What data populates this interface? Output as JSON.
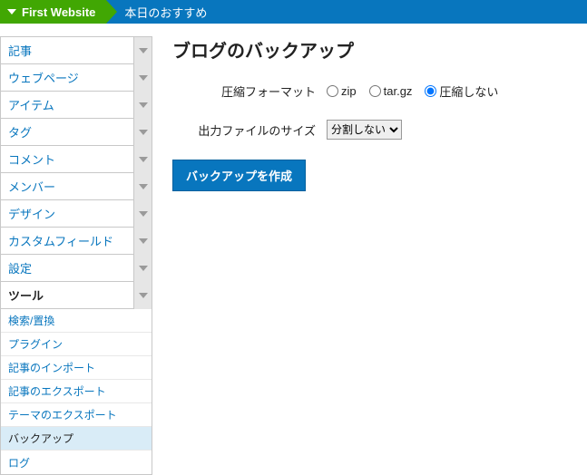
{
  "breadcrumb": {
    "site": "First Website",
    "page": "本日のおすすめ"
  },
  "sidebar": {
    "items": [
      {
        "label": "記事",
        "active": false
      },
      {
        "label": "ウェブページ",
        "active": false
      },
      {
        "label": "アイテム",
        "active": false
      },
      {
        "label": "タグ",
        "active": false
      },
      {
        "label": "コメント",
        "active": false
      },
      {
        "label": "メンバー",
        "active": false
      },
      {
        "label": "デザイン",
        "active": false
      },
      {
        "label": "カスタムフィールド",
        "active": false
      },
      {
        "label": "設定",
        "active": false
      },
      {
        "label": "ツール",
        "active": true
      }
    ],
    "subitems": [
      {
        "label": "検索/置換",
        "current": false
      },
      {
        "label": "プラグイン",
        "current": false
      },
      {
        "label": "記事のインポート",
        "current": false
      },
      {
        "label": "記事のエクスポート",
        "current": false
      },
      {
        "label": "テーマのエクスポート",
        "current": false
      },
      {
        "label": "バックアップ",
        "current": true
      },
      {
        "label": "ログ",
        "current": false
      }
    ]
  },
  "main": {
    "title": "ブログのバックアップ",
    "format_label": "圧縮フォーマット",
    "format_options": {
      "zip": "zip",
      "targz": "tar.gz",
      "none": "圧縮しない"
    },
    "format_selected": "none",
    "size_label": "出力ファイルのサイズ",
    "size_selected": "分割しない",
    "submit": "バックアップを作成"
  }
}
